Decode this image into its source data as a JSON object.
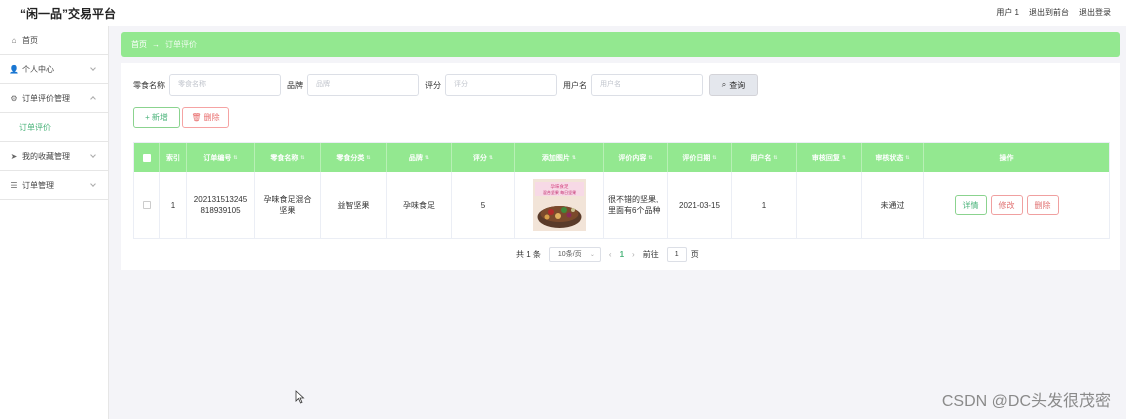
{
  "app": {
    "title": "“闲一品”交易平台",
    "top_links": [
      "用户 1",
      "退出到前台",
      "退出登录"
    ]
  },
  "sidebar": {
    "items": [
      {
        "label": "首页",
        "icon": "home-icon",
        "has_chevron": false
      },
      {
        "label": "个人中心",
        "icon": "user-icon",
        "has_chevron": true
      },
      {
        "label": "订单评价管理",
        "icon": "gear-icon",
        "has_chevron": true,
        "expanded": true
      },
      {
        "label": "我的收藏管理",
        "icon": "send-icon",
        "has_chevron": true
      },
      {
        "label": "订单管理",
        "icon": "list-icon",
        "has_chevron": true
      }
    ],
    "sub_item": "订单评价"
  },
  "breadcrumb": {
    "home": "首页",
    "sep": "→",
    "current": "订单评价"
  },
  "filters": [
    {
      "label": "零食名称",
      "placeholder": "零食名称"
    },
    {
      "label": "品牌",
      "placeholder": "品牌"
    },
    {
      "label": "评分",
      "placeholder": "评分"
    },
    {
      "label": "用户名",
      "placeholder": "用户名"
    }
  ],
  "buttons": {
    "search": "查询",
    "add": "新增",
    "delete": "删除"
  },
  "table": {
    "columns": [
      "索引",
      "订单编号",
      "零食名称",
      "零食分类",
      "品牌",
      "评分",
      "添加图片",
      "评价内容",
      "评价日期",
      "用户名",
      "审核回复",
      "审核状态",
      "操作"
    ],
    "rows": [
      {
        "index": "1",
        "order_no": "202131513245 818939105",
        "snack_name": "孕味食足混合坚果",
        "category": "益智坚果",
        "brand": "孕味食足",
        "score": "5",
        "image_caption": "孕味食足 混合坚果 每日坚果",
        "review": "很不错的坚果, 里面有6个品种",
        "date": "2021-03-15",
        "user": "1",
        "reply": "",
        "status": "未通过",
        "ops": {
          "detail": "详情",
          "edit": "修改",
          "delete": "删除"
        }
      }
    ]
  },
  "pager": {
    "total": "共 1 条",
    "page_size": "10条/页",
    "current": "1",
    "goto_label": "前往",
    "goto_value": "1",
    "page_unit": "页"
  },
  "watermark": "CSDN @DC头发很茂密",
  "colors": {
    "accent_green": "#93e890",
    "text_green": "#4ab37a",
    "danger": "#e07070"
  }
}
